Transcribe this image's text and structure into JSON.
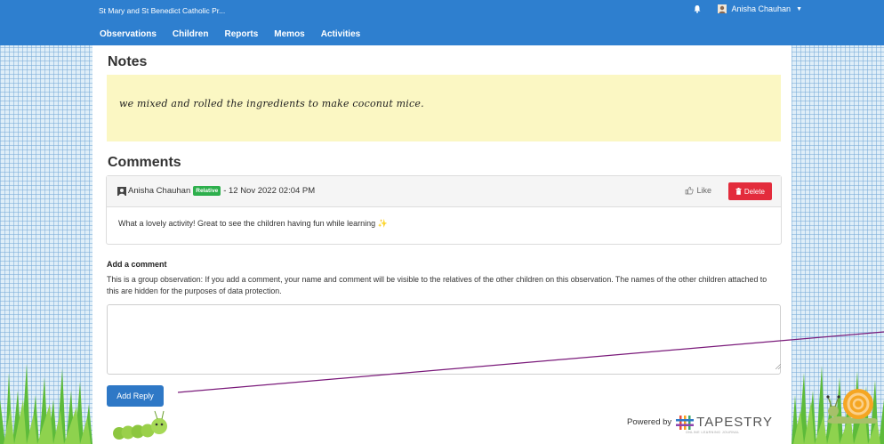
{
  "navbar": {
    "school_name": "St Mary and St Benedict Catholic Pr...",
    "links": [
      "Observations",
      "Children",
      "Reports",
      "Memos",
      "Activities"
    ],
    "user_name": "Anisha Chauhan",
    "bar_color": "#2e7fcf"
  },
  "notes": {
    "title": "Notes",
    "text": "we mixed and rolled the ingredients to make coconut mice."
  },
  "comments": {
    "title": "Comments",
    "items": [
      {
        "author": "Anisha Chauhan",
        "role_badge": "Relative",
        "timestamp": "- 12 Nov 2022 02:04 PM",
        "like_label": "Like",
        "delete_label": "Delete",
        "body": "What a lovely activity! Great to see the children having fun while learning",
        "body_emoji": "✨"
      }
    ]
  },
  "add_comment": {
    "label": "Add a comment",
    "notice": "This is a group observation: If you add a comment, your name and comment will be visible to the relatives of the other children on this observation. The names of the other children attached to this are hidden for the purposes of data protection.",
    "textarea_value": "",
    "submit_label": "Add Reply"
  },
  "footer": {
    "powered_by": "Powered by",
    "brand": "TAPESTRY",
    "brand_tagline": "ONLINE LEARNING JOURNAL"
  },
  "colors": {
    "accent": "#2e78c6",
    "delete": "#e32c3c",
    "relative_badge": "#2daf4c",
    "notes_bg": "#fbf7c3"
  }
}
